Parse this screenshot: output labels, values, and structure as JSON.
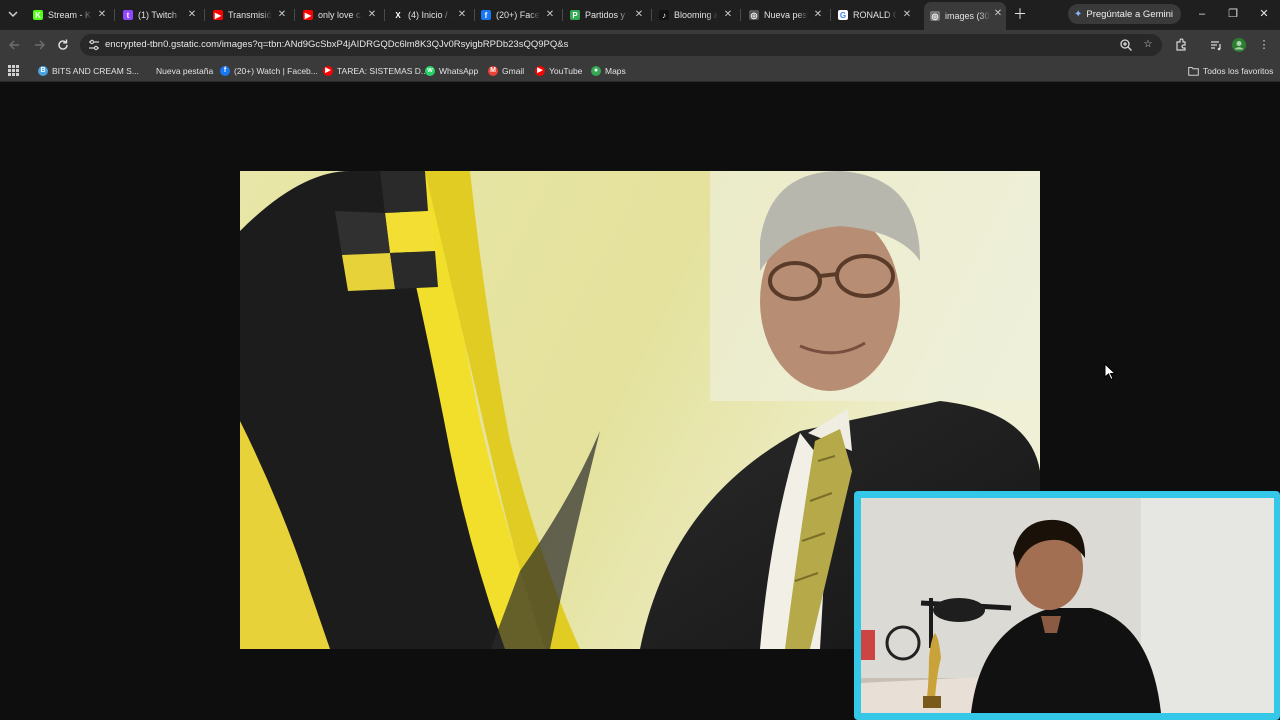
{
  "tabs": [
    {
      "title": "Stream - Ki",
      "favicon": "kick-icon",
      "color": "#53fc18",
      "glyph": "K",
      "active": false
    },
    {
      "title": "(1) Twitch",
      "favicon": "twitch-icon",
      "color": "#9146ff",
      "glyph": "t",
      "active": false
    },
    {
      "title": "Transmisión",
      "favicon": "youtube-icon",
      "color": "#ff0000",
      "glyph": "▶",
      "active": false
    },
    {
      "title": "only love ca",
      "favicon": "youtube-icon",
      "color": "#ff0000",
      "glyph": "▶",
      "active": false
    },
    {
      "title": "(4) Inicio / X",
      "favicon": "x-icon",
      "color": "#1f1f1f",
      "glyph": "X",
      "active": false
    },
    {
      "title": "(20+) Faceb",
      "favicon": "facebook-icon",
      "color": "#1877f2",
      "glyph": "f",
      "active": false
    },
    {
      "title": "Partidos y r",
      "favicon": "sheets-icon",
      "color": "#34a853",
      "glyph": "P",
      "active": false
    },
    {
      "title": "Blooming a",
      "favicon": "tiktok-icon",
      "color": "#111111",
      "glyph": "♪",
      "active": false
    },
    {
      "title": "Nueva pest",
      "favicon": "chrome-icon",
      "color": "#555555",
      "glyph": "◎",
      "active": false
    },
    {
      "title": "RONALD C",
      "favicon": "google-icon",
      "color": "#ffffff",
      "glyph": "G",
      "active": false
    },
    {
      "title": "images (30",
      "favicon": "globe-icon",
      "color": "#777777",
      "glyph": "◎",
      "active": true
    }
  ],
  "gemini_label": "Pregúntale a Gemini",
  "url": "encrypted-tbn0.gstatic.com/images?q=tbn:ANd9GcSbxP4jAIDRGQDc6lm8K3QJv0RsyigbRPDb23sQQ9PQ&s",
  "bookmarks": [
    {
      "label": "BITS AND CREAM S...",
      "icon": "bits-cream-icon",
      "color": "#4aa3df",
      "glyph": "B"
    },
    {
      "label": "Nueva pestaña",
      "icon": "none",
      "color": "",
      "glyph": ""
    },
    {
      "label": "(20+) Watch | Faceb...",
      "icon": "facebook-icon",
      "color": "#1877f2",
      "glyph": "f"
    },
    {
      "label": "TAREA: SISTEMAS D...",
      "icon": "youtube-icon",
      "color": "#ff0000",
      "glyph": "▶"
    },
    {
      "label": "WhatsApp",
      "icon": "whatsapp-icon",
      "color": "#25d366",
      "glyph": "w"
    },
    {
      "label": "Gmail",
      "icon": "gmail-icon",
      "color": "#ea4335",
      "glyph": "M"
    },
    {
      "label": "YouTube",
      "icon": "youtube-icon",
      "color": "#ff0000",
      "glyph": "▶"
    },
    {
      "label": "Maps",
      "icon": "maps-icon",
      "color": "#34a853",
      "glyph": "●"
    }
  ],
  "all_bookmarks_label": "Todos los favoritos",
  "colors": {
    "accent": "#8ab4f8",
    "webcam_border": "#35c7e8"
  }
}
